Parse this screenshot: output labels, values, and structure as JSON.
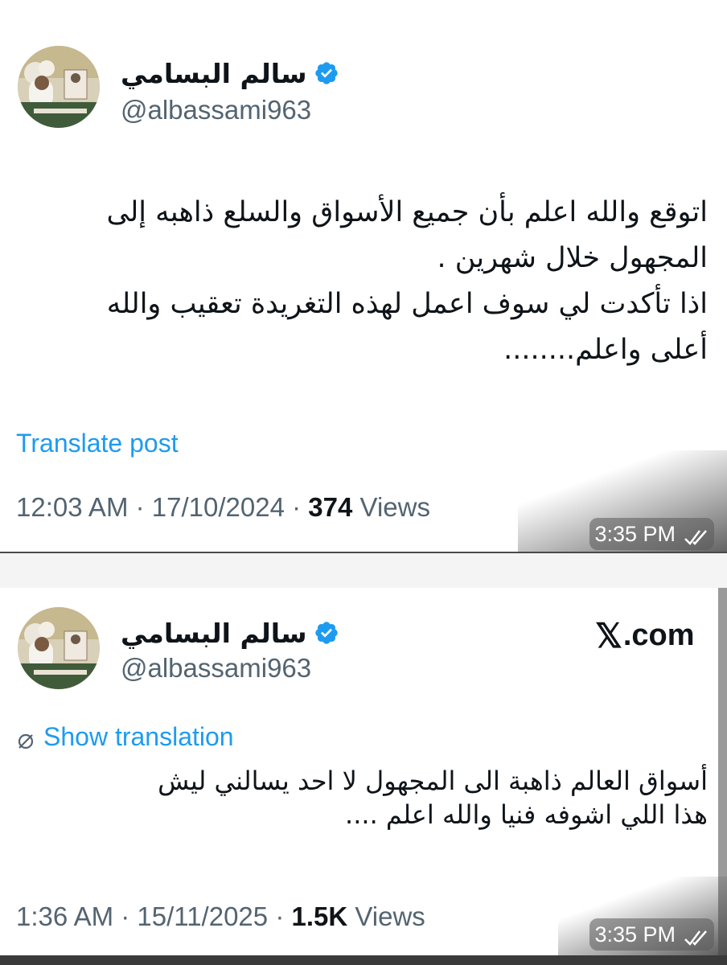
{
  "posts": [
    {
      "author": {
        "display_name": "سالم البسامي",
        "handle": "@albassami963",
        "verified": true
      },
      "text": "اتوقع والله اعلم بأن جميع الأسواق والسلع ذاهبه إلى\nالمجهول خلال شهرين .\nاذا تأكدت لي سوف اعمل لهذه التغريدة تعقيب والله\nأعلى واعلم........",
      "translate_label": "Translate post",
      "time": "12:03 AM",
      "date": "17/10/2024",
      "views_count": "374",
      "views_label": "Views",
      "chat_timestamp": "3:35 PM"
    },
    {
      "author": {
        "display_name": "سالم البسامي",
        "handle": "@albassami963",
        "verified": true
      },
      "source_label": "com",
      "source_mark": "𝕏",
      "translate_label": "Show translation",
      "text": "أسواق العالم ذاهبة الى المجهول لا احد يسالني ليش\nهذا اللي اشوفه فنيا والله اعلم ....",
      "time": "1:36 AM",
      "date": "15/11/2025",
      "views_count": "1.5K",
      "views_label": "Views",
      "chat_timestamp": "3:35 PM"
    }
  ],
  "colors": {
    "link": "#1d9bf0",
    "verified": "#1d9bf0",
    "secondary_text": "#536471"
  },
  "icons": [
    "verified-badge-icon",
    "translate-icon",
    "read-receipt-icon"
  ]
}
